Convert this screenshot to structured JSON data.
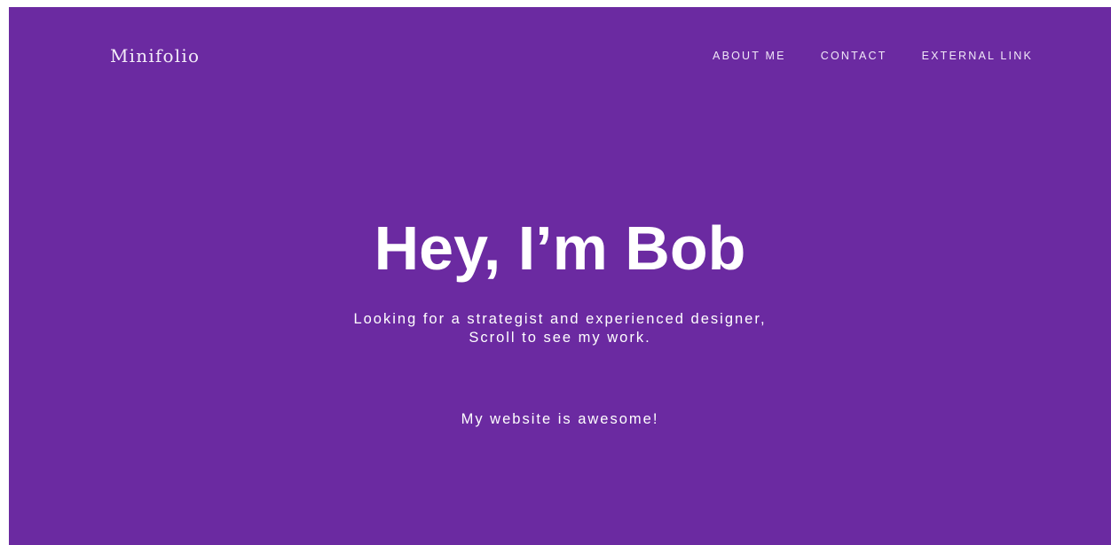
{
  "header": {
    "brand": "Minifolio",
    "nav": [
      {
        "label": "ABOUT ME"
      },
      {
        "label": "CONTACT"
      },
      {
        "label": "EXTERNAL LINK"
      }
    ]
  },
  "hero": {
    "title": "Hey, I’m Bob",
    "subtitle_line1": "Looking for a strategist and experienced designer,",
    "subtitle_line2": "Scroll to see my work.",
    "tagline": "My website is awesome!"
  },
  "colors": {
    "background": "#6b2aa1",
    "text": "#ffffff"
  }
}
